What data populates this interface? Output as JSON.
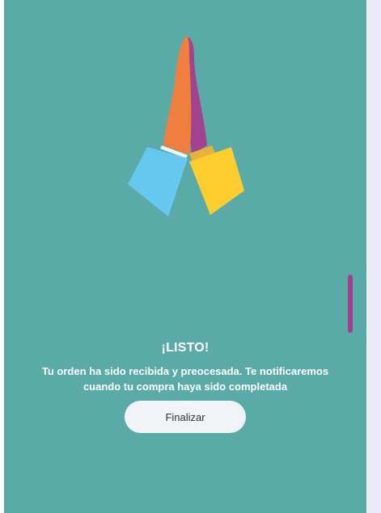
{
  "illustration": {
    "icon": "praying-hands-icon"
  },
  "confirmation": {
    "title": "¡LISTO!",
    "message": "Tu orden ha sido recibida y preocesada. Te notificaremos cuando tu compra haya sido completada"
  },
  "actions": {
    "finish_label": "Finalizar"
  },
  "colors": {
    "background": "#5aaba8",
    "accent": "#a0418f",
    "button_bg": "#f1f4f7"
  }
}
